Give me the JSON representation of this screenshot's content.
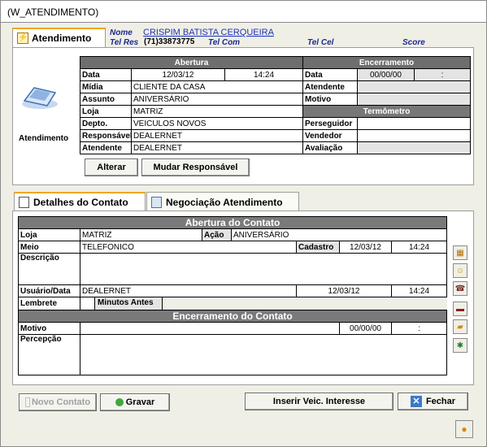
{
  "window": {
    "title": "(W_ATENDIMENTO)"
  },
  "top_tab": {
    "label": "Atendimento"
  },
  "contact": {
    "nome_label": "Nome",
    "nome_value": "CRISPIM BATISTA CERQUEIRA",
    "tel_res_label": "Tel Res",
    "tel_res_value": "(71)33873775",
    "tel_com_label": "Tel Com",
    "tel_cel_label": "Tel Cel",
    "score_label": "Score"
  },
  "left_icon_label": "Atendimento",
  "abertura": {
    "header": "Abertura",
    "data_label": "Data",
    "data_value": "12/03/12",
    "hora_value": "14:24",
    "midia_label": "Mídia",
    "midia_value": "CLIENTE DA CASA",
    "assunto_label": "Assunto",
    "assunto_value": "ANIVERSÁRIO",
    "loja_label": "Loja",
    "loja_value": "MATRIZ",
    "depto_label": "Depto.",
    "depto_value": "VEICULOS NOVOS",
    "responsavel_label": "Responsável",
    "responsavel_value": "DEALERNET",
    "atendente_label": "Atendente",
    "atendente_value": "DEALERNET"
  },
  "encerramento": {
    "header": "Encerramento",
    "data_label": "Data",
    "data_value": "00/00/00",
    "hora_value": ":",
    "atendente_label": "Atendente",
    "motivo_label": "Motivo",
    "termometro_header": "Termômetro",
    "perseguidor_label": "Perseguidor",
    "vendedor_label": "Vendedor",
    "avaliacao_label": "Avaliação"
  },
  "buttons_top": {
    "alterar": "Alterar",
    "mudar": "Mudar Responsável"
  },
  "tabs2": {
    "detalhes": "Detalhes do Contato",
    "negociacao": "Negociação Atendimento"
  },
  "contato": {
    "abertura_header": "Abertura do Contato",
    "loja_label": "Loja",
    "loja_value": "MATRIZ",
    "acao_label": "Ação",
    "acao_value": "ANIVERSÁRIO",
    "meio_label": "Meio",
    "meio_value": "TELEFONICO",
    "cadastro_label": "Cadastro",
    "cadastro_data": "12/03/12",
    "cadastro_hora": "14:24",
    "descricao_label": "Descrição",
    "usuario_label": "Usuário/Data",
    "usuario_value": "DEALERNET",
    "usuario_data": "12/03/12",
    "usuario_hora": "14:24",
    "lembrete_label": "Lembrete",
    "minutos_label": "Minutos Antes",
    "encerramento_header": "Encerramento do Contato",
    "motivo_label": "Motivo",
    "motivo_data": "00/00/00",
    "motivo_hora": ":",
    "percepcao_label": "Percepção"
  },
  "buttons_bottom": {
    "novo": "Novo Contato",
    "gravar": "Gravar",
    "inserir": "Inserir Veic. Interesse",
    "fechar": "Fechar"
  },
  "side_icons": [
    "calendar-icon",
    "smiley-icon",
    "phone-icon",
    "car-icon",
    "folder-icon",
    "bug-icon"
  ]
}
